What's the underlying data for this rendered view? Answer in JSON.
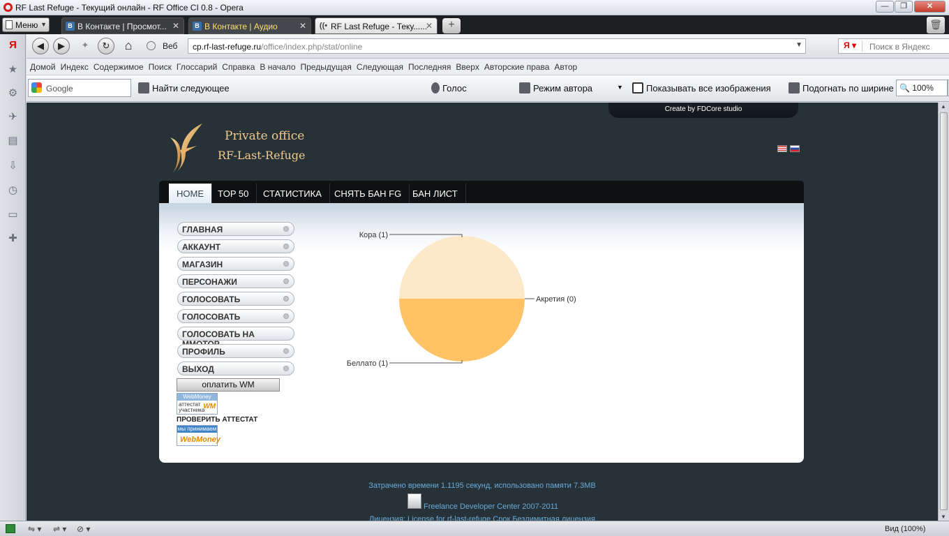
{
  "window": {
    "title": "RF Last Refuge - Текущий онлайн - RF Office CI 0.8 - Opera",
    "minimize": "—",
    "maximize": "❐",
    "close": "✕"
  },
  "tabs": {
    "menu_label": "Меню",
    "items": [
      {
        "label": "В Контакте | Просмот...",
        "favicon": "B"
      },
      {
        "label": "В Контакте | Аудио",
        "favicon": "B"
      },
      {
        "label": "RF Last Refuge - Теку......",
        "favicon": "((•"
      }
    ],
    "close_glyph": "✕",
    "new_tab": "+",
    "trash": "🗑"
  },
  "address": {
    "back": "◀",
    "forward": "▶",
    "wand": "✦",
    "reload": "↻",
    "home": "⌂",
    "web_label": "Веб",
    "url_domain": "cp.rf-last-refuge.ru",
    "url_path": "/office/index.php/stat/online",
    "url_dropdown": "▼",
    "search_engine": "Я ▾",
    "search_placeholder": "Поиск в Яндекс",
    "search_go": "🔍"
  },
  "navlinks": [
    "Домой",
    "Индекс",
    "Содержимое",
    "Поиск",
    "Глоссарий",
    "Справка",
    "В начало",
    "Предыдущая",
    "Следующая",
    "Последняя",
    "Вверх",
    "Авторские права",
    "Автор"
  ],
  "toolbar": {
    "google_placeholder": "Google",
    "find_next": "Найти следующее",
    "voice": "Голос",
    "author_mode": "Режим автора",
    "dropdown": "▼",
    "show_images": "Показывать все изображения",
    "fit_width": "Подогнать по ширине",
    "zoom": "🔍 100%",
    "zoom_dd": "▼"
  },
  "site": {
    "fdcore": "Create by FDCore studio",
    "title": "Private office",
    "subtitle": "RF-Last-Refuge",
    "nav": [
      "HOME",
      "TOP 50",
      "СТАТИСТИКА",
      "СНЯТЬ БАН FG",
      "БАН ЛИСТ"
    ],
    "menu": [
      "ГЛАВНАЯ",
      "АККАУНТ",
      "МАГАЗИН",
      "ПЕРСОНАЖИ",
      "ГОЛОСОВАТЬ",
      "ГОЛОСОВАТЬ",
      "ГОЛОСОВАТЬ НА MMOTOP",
      "ПРОФИЛЬ",
      "ВЫХОД"
    ],
    "pay_wm": "оплатить WM",
    "wm1_top": "WebMoney",
    "wm1_text": "аттестат участника",
    "wm1_logo": "WM",
    "check_attestat": "ПРОВЕРИТЬ АТТЕСТАТ",
    "wm2_top": "мы принимаем",
    "wm2_logo": "WebMoney",
    "footer_time": "Затрачено времени 1.1195 секунд, использовано памяти 7.3MB",
    "footer_fdc": "Freelance Developer Center 2007-2011",
    "footer_license": "Лицензия: License for rf-last-refuge Срок Безлимитная лицензия"
  },
  "sidebar_icons": [
    "Я",
    "★",
    "⚙",
    "✈",
    "▤",
    "⇩",
    "◷",
    "▭",
    "✚"
  ],
  "status": {
    "zoom": "Вид (100%)",
    "icons": [
      "⇋ ▾",
      "⇌ ▾",
      "⊘ ▾"
    ]
  },
  "colors": {
    "page_bg": "#263238",
    "slice_kora": "#fde8c8",
    "slice_bellato": "#ffc366",
    "title_gold": "#f1c98a",
    "footer_link": "#6aaad8"
  },
  "chart_data": {
    "type": "pie",
    "slices": [
      {
        "label": "Кора (1)",
        "value": 1,
        "color": "#fde8c8"
      },
      {
        "label": "Акретия (0)",
        "value": 0,
        "color": "#ffd9a0"
      },
      {
        "label": "Беллато (1)",
        "value": 1,
        "color": "#ffc366"
      }
    ]
  }
}
